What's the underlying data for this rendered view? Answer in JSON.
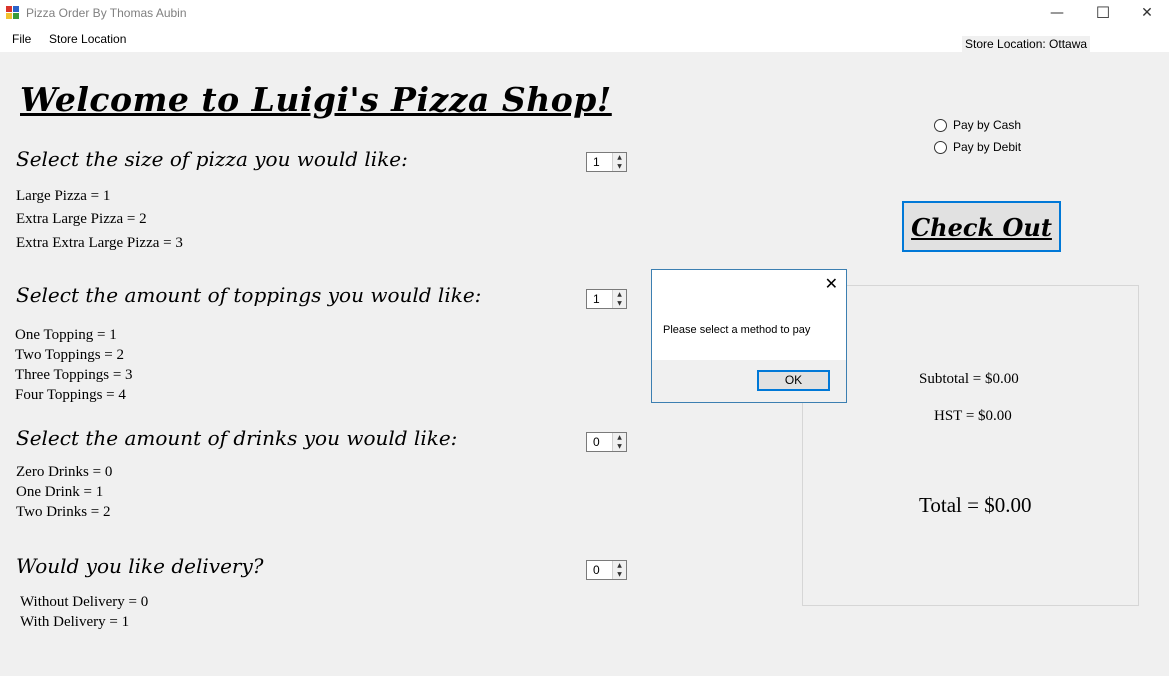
{
  "window": {
    "title": "Pizza Order By Thomas Aubin",
    "minimize_glyph": "—",
    "maximize_glyph": "☐",
    "close_glyph": "✕"
  },
  "menu": {
    "file": "File",
    "store_location": "Store Location"
  },
  "store_location_label": "Store Location: Ottawa",
  "welcome": "Welcome to Luigi's Pizza Shop!",
  "size": {
    "question": "Select the size of pizza you would like:",
    "value": "1",
    "options": [
      "Large Pizza = 1",
      "Extra Large Pizza = 2",
      "Extra Extra Large Pizza = 3"
    ]
  },
  "toppings": {
    "question": "Select the amount of toppings you would like:",
    "value": "1",
    "options": [
      "One Topping = 1",
      "Two Toppings = 2",
      "Three Toppings = 3",
      "Four Toppings = 4"
    ]
  },
  "drinks": {
    "question": "Select the amount of drinks you would like:",
    "value": "0",
    "options": [
      "Zero Drinks = 0",
      "One Drink = 1",
      "Two Drinks = 2"
    ]
  },
  "delivery": {
    "question": "Would you like delivery?",
    "value": "0",
    "options": [
      "Without Delivery = 0",
      "With Delivery = 1"
    ]
  },
  "payment": {
    "cash": "Pay by Cash",
    "debit": "Pay by Debit"
  },
  "checkout_label": "Check Out",
  "summary": {
    "subtotal": "Subtotal = $0.00",
    "hst": "HST = $0.00",
    "total": "Total = $0.00"
  },
  "dialog": {
    "message": "Please select a method to pay",
    "ok": "OK",
    "close_glyph": "✕"
  },
  "icon_colors": {
    "red": "#d9342b",
    "blue": "#2a62c9",
    "yellow": "#f2c230",
    "green": "#3a9b3a"
  }
}
